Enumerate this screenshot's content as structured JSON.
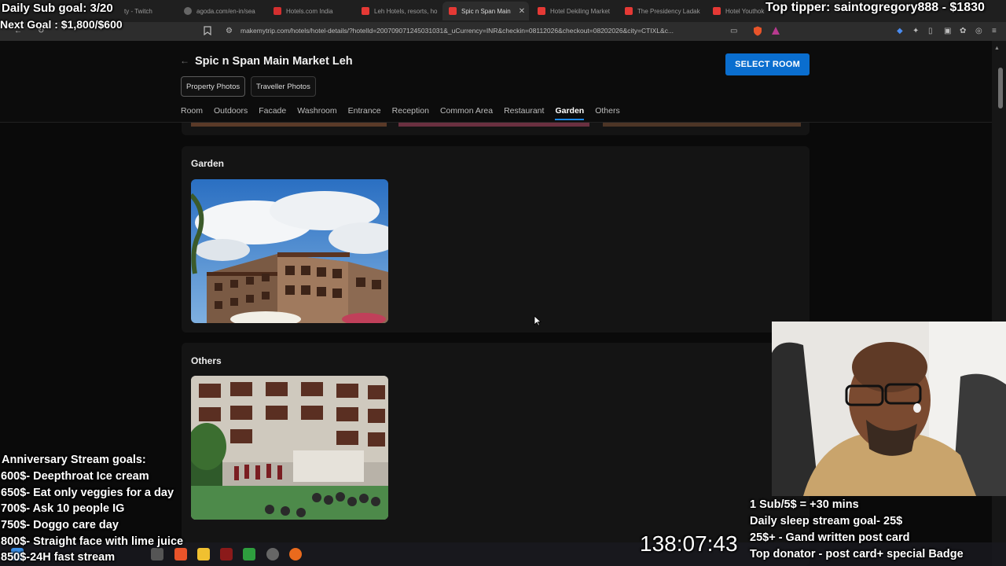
{
  "browser": {
    "tabs": [
      {
        "label": "ty - Twitch",
        "color": "#9146ff",
        "active": false
      },
      {
        "label": "agoda.com/en-in/sea",
        "color": "#888888",
        "active": false
      },
      {
        "label": "Hotels.com India",
        "color": "#d32f2f",
        "active": false
      },
      {
        "label": "Leh Hotels, resorts, ho",
        "color": "#e53935",
        "active": false
      },
      {
        "label": "Spic n Span Main",
        "color": "#e53935",
        "active": true
      },
      {
        "label": "Hotel Dekiling Market",
        "color": "#e53935",
        "active": false
      },
      {
        "label": "The Presidency Ladak",
        "color": "#e53935",
        "active": false
      },
      {
        "label": "Hotel Youthok H",
        "color": "#e53935",
        "active": false
      }
    ],
    "url": "makemytrip.com/hotels/hotel-details/?hotelId=200709071245031031&_uCurrency=INR&checkin=08112026&checkout=08202026&city=CTIXL&c..."
  },
  "page": {
    "title": "Spic n Span Main Market Leh",
    "select_room": "SELECT ROOM",
    "photo_tabs": [
      "Property Photos",
      "Traveller Photos"
    ],
    "categories": [
      "Room",
      "Outdoors",
      "Facade",
      "Washroom",
      "Entrance",
      "Reception",
      "Common Area",
      "Restaurant",
      "Garden",
      "Others"
    ],
    "active_category": "Garden",
    "sections": [
      {
        "title": "Garden"
      },
      {
        "title": "Others"
      }
    ]
  },
  "overlay": {
    "sub_goal": "Daily Sub goal: 3/20",
    "next_goal": "Next Goal : $1,800/$600",
    "top_tipper": "Top tipper: saintogregory888 - $1830",
    "anniversary_title": "Anniversary Stream goals:",
    "anniversary_goals": [
      "600$- Deepthroat Ice cream",
      "650$- Eat only veggies for a day",
      "700$- Ask 10 people IG",
      "750$- Doggo care day",
      "800$- Straight face with lime juice",
      "850$-24H fast stream"
    ],
    "timer": "138:07:43",
    "rules": [
      "1 Sub/5$ = +30 mins",
      "Daily sleep stream goal- 25$",
      "25$+ - Gand written post card",
      "Top donator - post card+ special Badge"
    ]
  },
  "colors": {
    "accent": "#0a6ecf",
    "active_tab_underline": "#1d8bf0"
  }
}
